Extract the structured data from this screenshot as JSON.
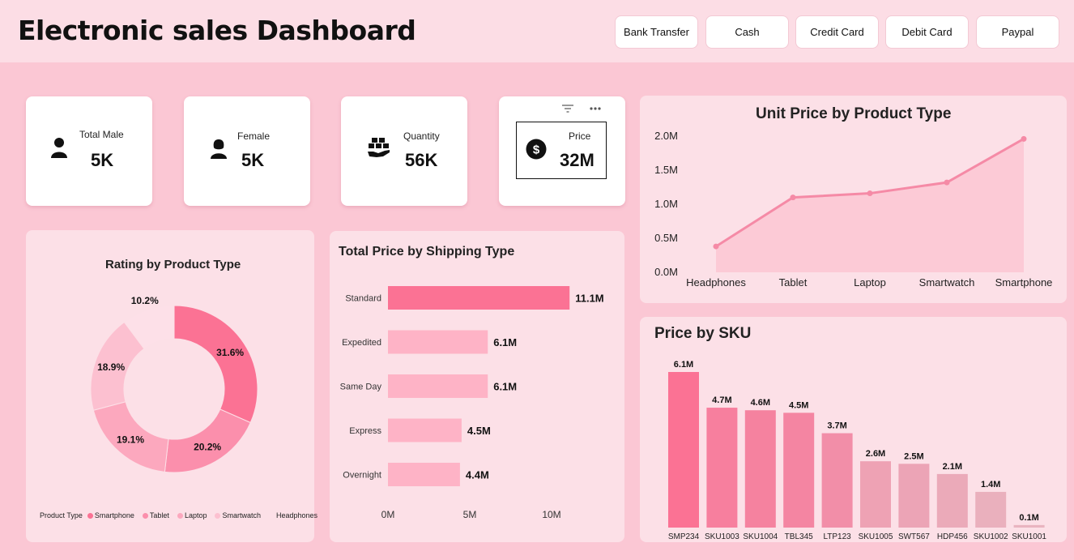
{
  "header": {
    "title": "Electronic sales Dashboard",
    "slicers": [
      "Bank Transfer",
      "Cash",
      "Credit Card",
      "Debit Card",
      "Paypal"
    ]
  },
  "kpis": {
    "male": {
      "label": "Total Male",
      "value": "5K",
      "icon": "person-male-icon"
    },
    "female": {
      "label": "Female",
      "value": "5K",
      "icon": "person-female-icon"
    },
    "quantity": {
      "label": "Quantity",
      "value": "56K",
      "icon": "boxes-hand-icon"
    },
    "price": {
      "label": "Price",
      "value": "32M",
      "icon": "dollar-circle-icon"
    }
  },
  "visual_header_icons": [
    "filter-icon",
    "more-options-icon"
  ],
  "colors": {
    "background": "#fbc7d4",
    "panel": "#fce0e7",
    "accent": "#fb7294",
    "bar_light": "#feb3c6",
    "line": "#f58aa6"
  },
  "chart_data": [
    {
      "id": "rating",
      "type": "pie",
      "title": "Rating by Product Type",
      "legend_title": "Product Type",
      "legend_position": "bottom",
      "categories": [
        "Smartphone",
        "Tablet",
        "Laptop",
        "Smartwatch",
        "Headphones"
      ],
      "values": [
        31.6,
        20.2,
        19.1,
        18.9,
        10.2
      ],
      "labels": [
        "31.6%",
        "20.2%",
        "19.1%",
        "18.9%",
        "10.2%"
      ],
      "colors": [
        "#fb7294",
        "#fb8fac",
        "#fca8be",
        "#fcc0d0",
        "#fde0e8"
      ]
    },
    {
      "id": "shipping",
      "type": "bar",
      "orientation": "horizontal",
      "title": "Total Price by Shipping Type",
      "categories": [
        "Standard",
        "Expedited",
        "Same Day",
        "Express",
        "Overnight"
      ],
      "values": [
        11.1,
        6.1,
        6.1,
        4.5,
        4.4
      ],
      "labels": [
        "11.1M",
        "6.1M",
        "6.1M",
        "4.5M",
        "4.4M"
      ],
      "xticks": [
        "0M",
        "5M",
        "10M"
      ],
      "xlim": [
        0,
        10
      ],
      "colors": [
        "#fb7294",
        "#feb3c6",
        "#feb3c6",
        "#feb3c6",
        "#feb3c6"
      ]
    },
    {
      "id": "unit_price",
      "type": "area",
      "title": "Unit Price by Product Type",
      "categories": [
        "Headphones",
        "Tablet",
        "Laptop",
        "Smartwatch",
        "Smartphone"
      ],
      "values": [
        0.38,
        1.1,
        1.16,
        1.32,
        1.96
      ],
      "yticks": [
        "0.0M",
        "0.5M",
        "1.0M",
        "1.5M",
        "2.0M"
      ],
      "ylim": [
        0,
        2
      ],
      "colors": [
        "#f58aa6"
      ]
    },
    {
      "id": "sku",
      "type": "bar",
      "title": "Price by SKU",
      "categories": [
        "SMP234",
        "SKU1003",
        "SKU1004",
        "TBL345",
        "LTP123",
        "SKU1005",
        "SWT567",
        "HDP456",
        "SKU1002",
        "SKU1001"
      ],
      "values": [
        6.1,
        4.7,
        4.6,
        4.5,
        3.7,
        2.6,
        2.5,
        2.1,
        1.4,
        0.1
      ],
      "labels": [
        "6.1M",
        "4.7M",
        "4.6M",
        "4.5M",
        "3.7M",
        "2.6M",
        "2.5M",
        "2.1M",
        "1.4M",
        "0.1M"
      ],
      "ylim": [
        0,
        6.1
      ],
      "colors": [
        "#fb7294",
        "#f77f9e",
        "#f5829f",
        "#f485a2",
        "#f28ea8",
        "#eea2b4",
        "#eca4b6",
        "#ebaab9",
        "#eab0bd",
        "#e9b4c0"
      ]
    }
  ]
}
